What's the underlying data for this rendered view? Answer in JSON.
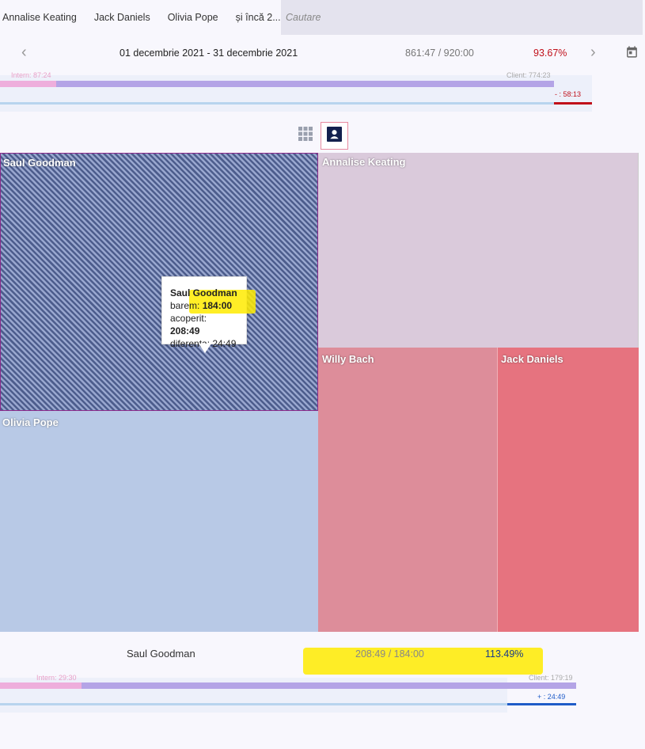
{
  "tabs": [
    "Annalise Keating",
    "Jack Daniels",
    "Olivia Pope",
    "și încă 2..."
  ],
  "search": {
    "placeholder": "Cautare"
  },
  "period": {
    "range": "01 decembrie 2021 - 31 decembrie 2021",
    "hours": "861:47 / 920:00",
    "percent": "93.67%"
  },
  "summary_top": {
    "intern": "Intern: 87:24",
    "client": "Client: 774:23",
    "diff": "- : 58:13"
  },
  "treemap": {
    "cells": [
      {
        "name": "Saul Goodman"
      },
      {
        "name": "Annalise Keating"
      },
      {
        "name": "Willy Bach"
      },
      {
        "name": "Jack Daniels"
      },
      {
        "name": "Olivia Pope"
      }
    ]
  },
  "tooltip": {
    "title": "Saul Goodman",
    "barem_label": "barem:",
    "barem_value": "184:00",
    "acoperit_label": "acoperit:",
    "acoperit_value": "208:49",
    "diferenta": "diferenta: 24:49"
  },
  "selected": {
    "name": "Saul Goodman",
    "hours": "208:49 / 184:00",
    "percent": "113.49%",
    "intern": "Intern: 29:30",
    "client": "Client: 179:19",
    "diff": "+ : 24:49"
  },
  "colors": {
    "accent_red": "#c0101a",
    "accent_blue": "#1f5cc8"
  }
}
